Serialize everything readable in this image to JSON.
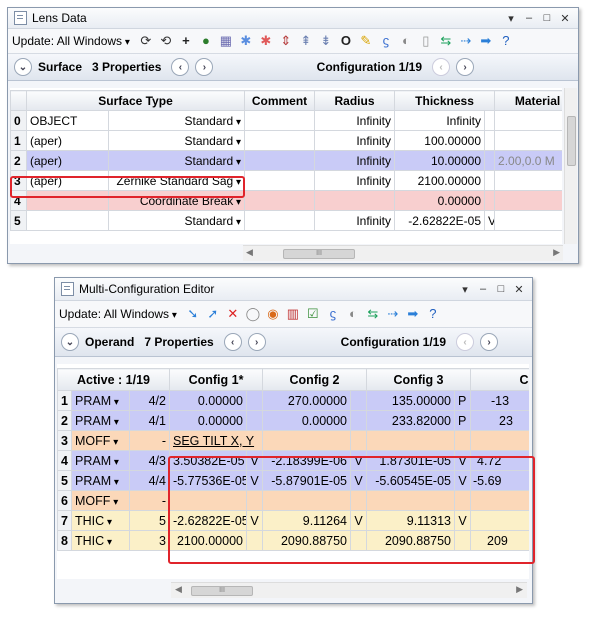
{
  "lens": {
    "title": "Lens Data",
    "update": "Update: All Windows",
    "info_left": "Surface",
    "info_props": "3 Properties",
    "config": "Configuration 1/19",
    "headers": [
      "",
      "Surface Type",
      "",
      "Comment",
      "Radius",
      "Thickness",
      "Material"
    ],
    "rows": [
      {
        "n": "0",
        "c1": "OBJECT",
        "type": "Standard",
        "comment": "",
        "radius": "Infinity",
        "thick": "Infinity",
        "flag": "",
        "mat": ""
      },
      {
        "n": "1",
        "c1": "(aper)",
        "type": "Standard",
        "comment": "",
        "radius": "Infinity",
        "thick": "100.00000",
        "flag": "",
        "mat": ""
      },
      {
        "n": "2",
        "c1": "(aper)",
        "type": "Standard",
        "comment": "",
        "radius": "Infinity",
        "thick": "10.00000",
        "flag": "",
        "mat": "2.00,0.0 M"
      },
      {
        "n": "3",
        "c1": "(aper)",
        "type": "Zernike Standard Sag",
        "comment": "",
        "radius": "Infinity",
        "thick": "2100.00000",
        "flag": "",
        "mat": ""
      },
      {
        "n": "4",
        "c1": "",
        "type": "Coordinate Break",
        "comment": "",
        "radius": "",
        "thick": "0.00000",
        "flag": "",
        "mat": "-"
      },
      {
        "n": "5",
        "c1": "",
        "type": "Standard",
        "comment": "",
        "radius": "Infinity",
        "thick": "-2.62822E-05",
        "flag": "V",
        "mat": ""
      }
    ]
  },
  "mce": {
    "title": "Multi-Configuration Editor",
    "update": "Update: All Windows",
    "info_left": "Operand",
    "info_props": "7 Properties",
    "config": "Configuration 1/19",
    "headers": [
      "Active : 1/19",
      "Config 1*",
      "Config 2",
      "Config 3",
      "C"
    ],
    "rows": [
      {
        "n": "1",
        "op": "PRAM",
        "p": "4/2",
        "c1": "0.00000",
        "f1": "",
        "c2": "270.00000",
        "f2": "",
        "c3": "135.00000",
        "f3": "P",
        "c4": "-13"
      },
      {
        "n": "2",
        "op": "PRAM",
        "p": "4/1",
        "c1": "0.00000",
        "f1": "",
        "c2": "0.00000",
        "f2": "",
        "c3": "233.82000",
        "f3": "P",
        "c4": "23"
      },
      {
        "n": "3",
        "op": "MOFF",
        "p": "-",
        "c1": "SEG TILT X, Y",
        "f1": "",
        "c2": "",
        "f2": "",
        "c3": "",
        "f3": "",
        "c4": ""
      },
      {
        "n": "4",
        "op": "PRAM",
        "p": "4/3",
        "c1": "3.50382E-05",
        "f1": "V",
        "c2": "-2.18399E-06",
        "f2": "V",
        "c3": "1.87301E-05",
        "f3": "V",
        "c4": "4.72"
      },
      {
        "n": "5",
        "op": "PRAM",
        "p": "4/4",
        "c1": "-5.77536E-05",
        "f1": "V",
        "c2": "-5.87901E-05",
        "f2": "V",
        "c3": "-5.60545E-05",
        "f3": "V",
        "c4": "-5.69"
      },
      {
        "n": "6",
        "op": "MOFF",
        "p": "-",
        "c1": "",
        "f1": "",
        "c2": "",
        "f2": "",
        "c3": "",
        "f3": "",
        "c4": ""
      },
      {
        "n": "7",
        "op": "THIC",
        "p": "5",
        "c1": "-2.62822E-05",
        "f1": "V",
        "c2": "9.11264",
        "f2": "V",
        "c3": "9.11313",
        "f3": "V",
        "c4": ""
      },
      {
        "n": "8",
        "op": "THIC",
        "p": "3",
        "c1": "2100.00000",
        "f1": "",
        "c2": "2090.88750",
        "f2": "",
        "c3": "2090.88750",
        "f3": "",
        "c4": "209"
      }
    ]
  },
  "scroll_glyph": "III"
}
